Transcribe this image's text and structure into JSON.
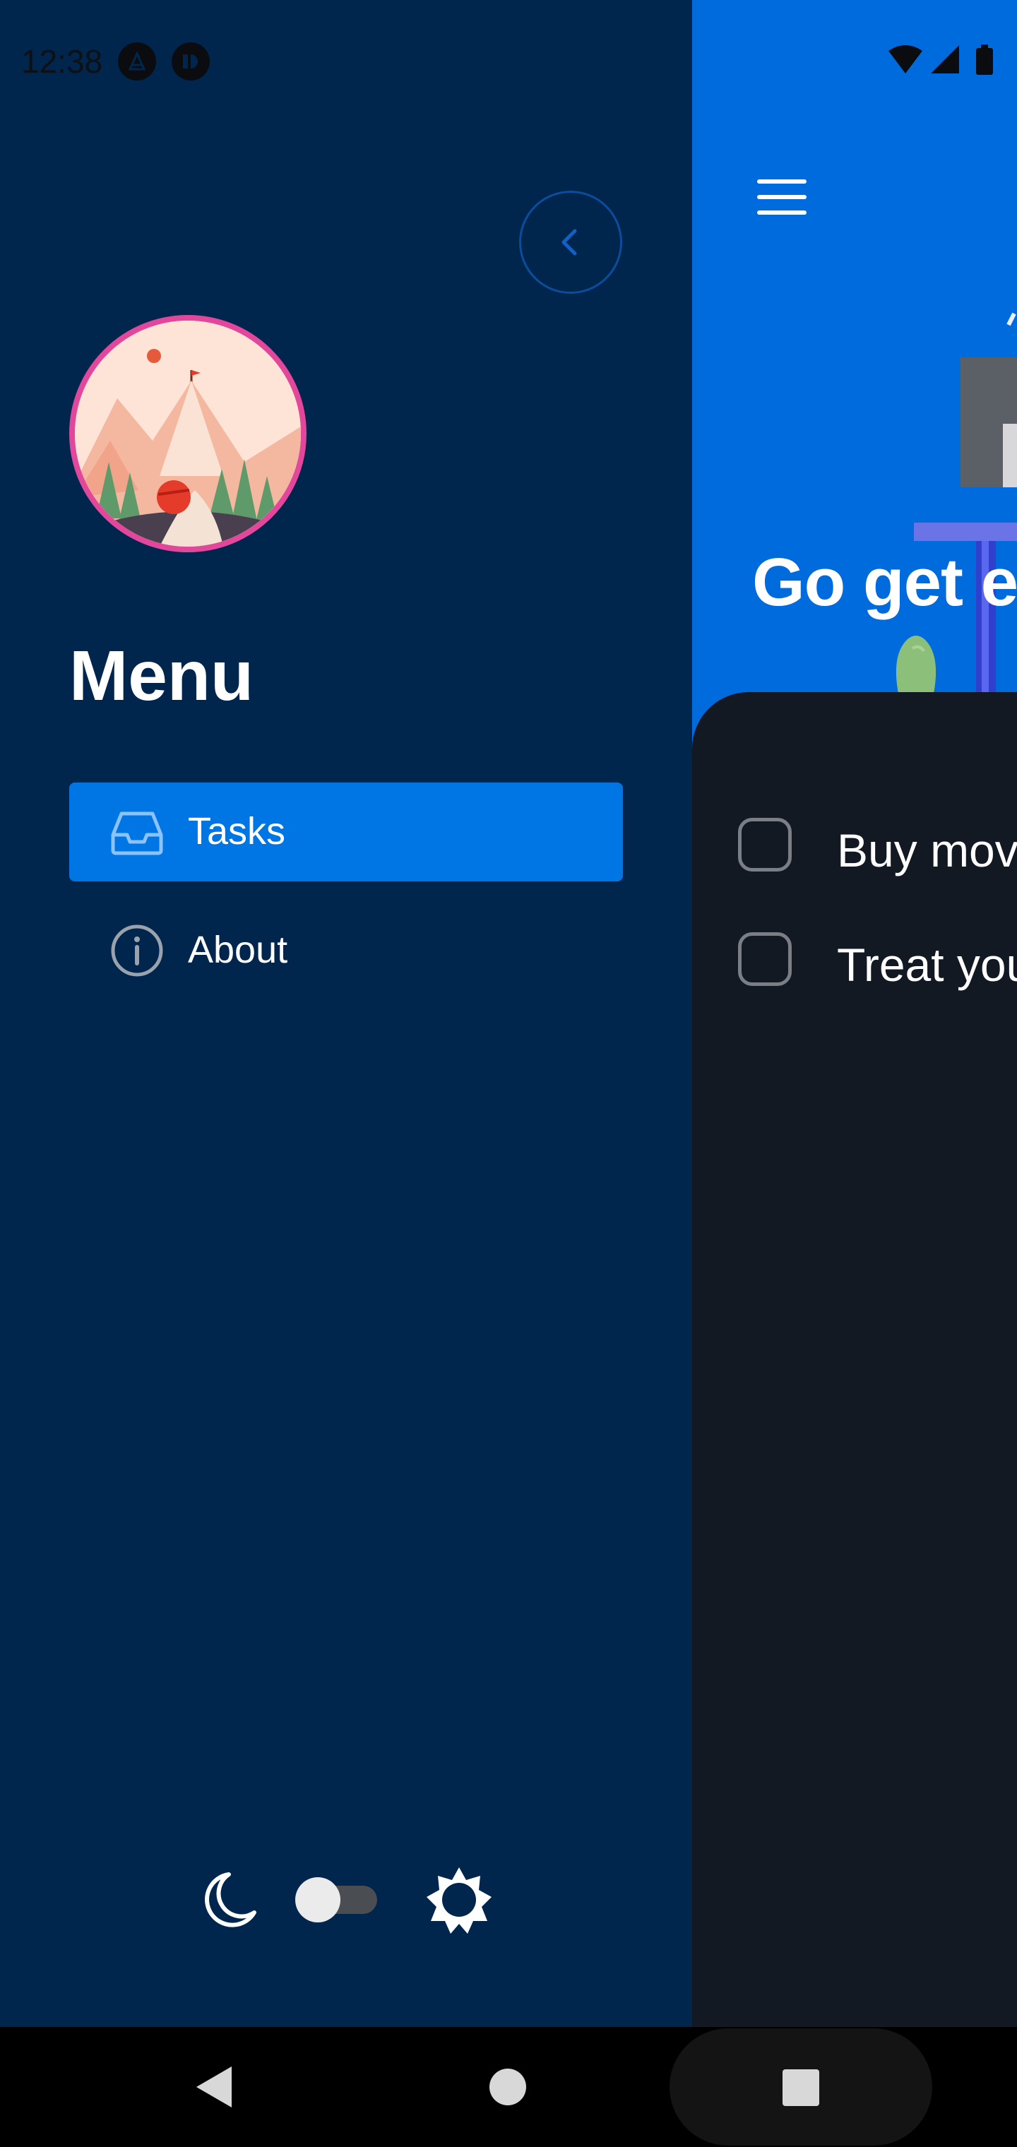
{
  "status_bar": {
    "time": "12:38"
  },
  "main": {
    "hero_title": "Go get e",
    "tasks": [
      {
        "label": "Buy mov"
      },
      {
        "label": "Treat you"
      }
    ]
  },
  "drawer": {
    "title": "Menu",
    "nav_items": [
      {
        "label": "Tasks",
        "icon": "inbox-icon",
        "active": true
      },
      {
        "label": "About",
        "icon": "info-icon",
        "active": false
      }
    ],
    "theme_toggle": {
      "mode": "dark"
    }
  },
  "colors": {
    "drawer_bg": "#00264d",
    "header_bg": "#006bdc",
    "active_nav": "#0075e4",
    "avatar_border": "#e3479b",
    "task_panel_bg": "#121922"
  }
}
